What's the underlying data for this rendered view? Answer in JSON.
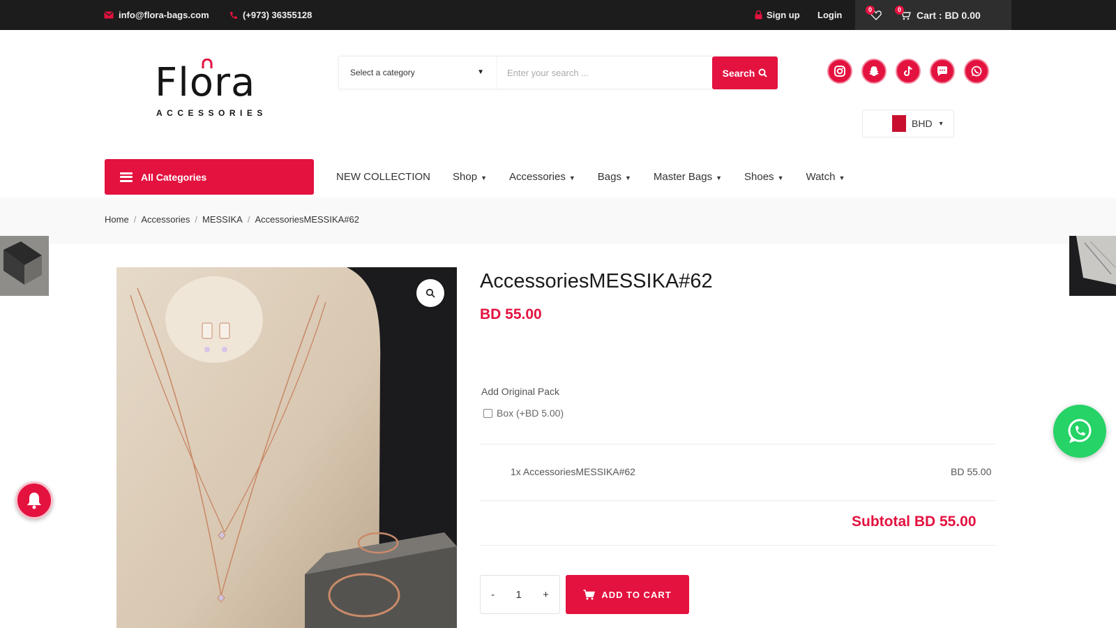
{
  "topbar": {
    "email": "info@flora-bags.com",
    "phone": "(+973) 36355128",
    "signup": "Sign up",
    "login": "Login",
    "wishlist_count": "0",
    "cart_count": "0",
    "cart_label": "Cart : BD 0.00"
  },
  "logo": {
    "word": "Flora",
    "sub": "ACCESSORIES"
  },
  "search": {
    "category": "Select a category",
    "placeholder": "Enter your search ...",
    "button": "Search"
  },
  "social": [
    "instagram-icon",
    "snapchat-icon",
    "tiktok-icon",
    "chat-icon",
    "whatsapp-icon"
  ],
  "currency": {
    "code": "BHD"
  },
  "nav": {
    "all_categories": "All Categories",
    "items": [
      "NEW COLLECTION",
      "Shop",
      "Accessories",
      "Bags",
      "Master Bags",
      "Shoes",
      "Watch"
    ]
  },
  "breadcrumb": [
    "Home",
    "Accessories",
    "MESSIKA",
    "AccessoriesMESSIKA#62"
  ],
  "product": {
    "title": "AccessoriesMESSIKA#62",
    "price": "BD 55.00",
    "pack_label": "Add Original Pack",
    "pack_option": "Box (+BD 5.00)",
    "line_item": "1x AccessoriesMESSIKA#62",
    "line_price": "BD 55.00",
    "subtotal": "Subtotal BD 55.00",
    "qty_minus": "-",
    "qty": "1",
    "qty_plus": "+",
    "add_to_cart": "ADD TO CART"
  },
  "colors": {
    "accent": "#e3123f",
    "topbar": "#1c1c1c",
    "whatsapp": "#25d366"
  }
}
